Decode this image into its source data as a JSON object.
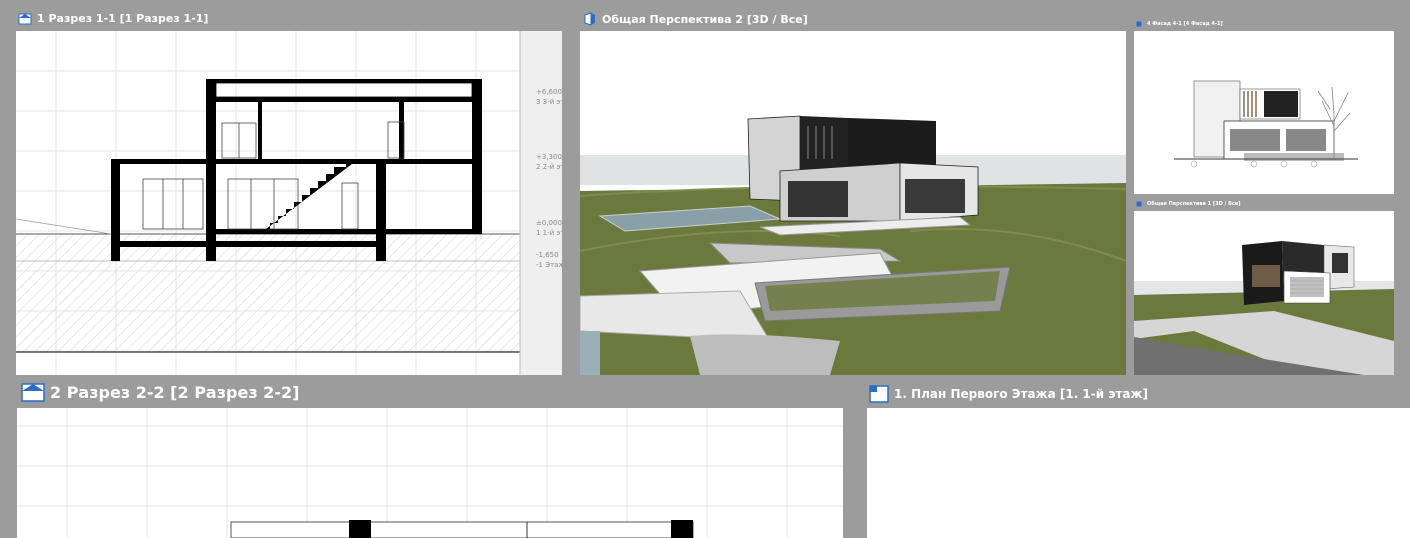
{
  "viewports": {
    "section_1": {
      "title": "1 Разрез 1-1 [1 Разрез 1-1]",
      "levels": [
        {
          "elev": "+6,600",
          "name": "3 3-й эт"
        },
        {
          "elev": "+3,300",
          "name": "2 2-й эт"
        },
        {
          "elev": "±0,000",
          "name": "1 1-й эт"
        },
        {
          "elev": "-1,650",
          "name": "-1 Этаж"
        }
      ]
    },
    "perspective_2": {
      "title": "Общая Перспектива 2 [3D / Все]"
    },
    "facade_4": {
      "title": "4 Фасад 4-1 [4 Фасад 4-1]"
    },
    "perspective_1": {
      "title": "Общая Перспектива 1 [3D / Все]"
    },
    "section_2": {
      "title": "2 Разрез 2-2 [2 Разрез 2-2]"
    },
    "plan_1": {
      "title": "1. План Первого Этажа [1. 1-й этаж]"
    }
  },
  "colors": {
    "workspace_bg": "#9c9c9c",
    "title_text": "#ffffff",
    "icon_blue": "#2b6cc4",
    "sky": "#dfe3e6",
    "grass": "#6a7a3c"
  },
  "icons": {
    "section": "section-view-icon",
    "perspective": "3d-view-icon",
    "elevation": "elevation-view-icon",
    "plan": "floor-plan-icon"
  }
}
